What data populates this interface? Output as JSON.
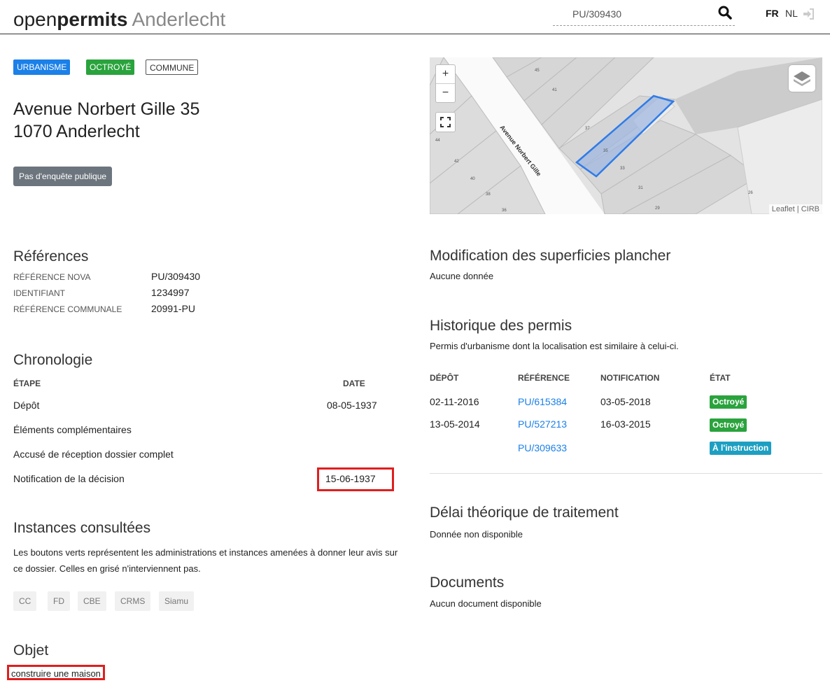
{
  "header": {
    "brand_open": "open",
    "brand_permits": "permits",
    "brand_city": "Anderlecht",
    "search_value": "PU/309430",
    "search_icon": "search-icon",
    "lang_fr": "FR",
    "lang_nl": "NL",
    "login_icon": "sign-in-icon"
  },
  "tags": [
    "URBANISME",
    "OCTROYÉ",
    "COMMUNE"
  ],
  "address": {
    "line1": "Avenue Norbert Gille 35",
    "line2": "1070 Anderlecht"
  },
  "enquete_badge": "Pas d'enquête publique",
  "map": {
    "zoom_in": "+",
    "zoom_out": "−",
    "fullscreen_icon": "fullscreen-icon",
    "layers_icon": "layers-icon",
    "street_label": "Avenue Norbert Gille",
    "attribution_leaflet": "Leaflet",
    "attribution_sep": " | ",
    "attribution_cirb": "CIRB",
    "house_numbers": [
      "45",
      "41",
      "37",
      "35",
      "33",
      "31",
      "29",
      "44",
      "42",
      "40",
      "38",
      "36",
      "26"
    ]
  },
  "references": {
    "title": "Références",
    "rows": [
      {
        "label": "RÉFÉRENCE NOVA",
        "value": "PU/309430"
      },
      {
        "label": "IDENTIFIANT",
        "value": "1234997"
      },
      {
        "label": "RÉFÉRENCE COMMUNALE",
        "value": "20991-PU"
      }
    ]
  },
  "chronologie": {
    "title": "Chronologie",
    "col_step": "ÉTAPE",
    "col_date": "DATE",
    "rows": [
      {
        "step": "Dépôt",
        "date": "08-05-1937"
      },
      {
        "step": "Éléments complémentaires",
        "date": ""
      },
      {
        "step": "Accusé de réception dossier complet",
        "date": ""
      },
      {
        "step": "Notification de la décision",
        "date": "15-06-1937"
      }
    ]
  },
  "instances": {
    "title": "Instances consultées",
    "description": "Les boutons verts représentent les administrations et instances amenées à donner leur avis sur ce dossier. Celles en grisé n'interviennent pas.",
    "chips": [
      "CC",
      "FD",
      "CBE",
      "CRMS",
      "Siamu"
    ]
  },
  "objet": {
    "title": "Objet",
    "value": "construire une maison"
  },
  "modification": {
    "title": "Modification des superficies plancher",
    "value": "Aucune donnée"
  },
  "historique": {
    "title": "Historique des permis",
    "description": "Permis d'urbanisme dont la localisation est similaire à celui-ci.",
    "col_depot": "DÉPÔT",
    "col_ref": "RÉFÉRENCE",
    "col_notif": "NOTIFICATION",
    "col_etat": "ÉTAT",
    "rows": [
      {
        "depot": "02-11-2016",
        "ref": "PU/615384",
        "notif": "03-05-2018",
        "etat": "Octroyé"
      },
      {
        "depot": "13-05-2014",
        "ref": "PU/527213",
        "notif": "16-03-2015",
        "etat": "Octroyé"
      },
      {
        "depot": "",
        "ref": "PU/309633",
        "notif": "",
        "etat": "À l'instruction"
      }
    ]
  },
  "delai": {
    "title": "Délai théorique de traitement",
    "value": "Donnée non disponible"
  },
  "documents": {
    "title": "Documents",
    "value": "Aucun document disponible"
  },
  "colors": {
    "urbanisme": "#1b80e8",
    "octroye": "#2aa33d",
    "instruction": "#1d9fc2",
    "highlight": "#e01e1e",
    "link": "#1b80e8"
  }
}
